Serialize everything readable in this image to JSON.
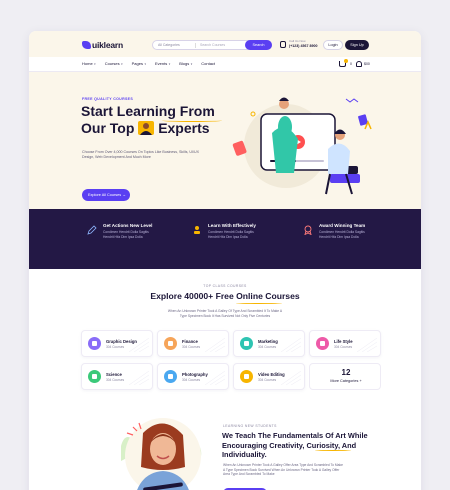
{
  "brand": {
    "name": "uiklearn",
    "accent": "#5a3ff2",
    "dark": "#231845",
    "yellow": "#f7b500",
    "cream": "#fbf6ea"
  },
  "header": {
    "category": "All Categories",
    "search_placeholder": "Search Courses",
    "search_label": "Search",
    "phone_label": "Call Us Now",
    "phone": "(+123) 4567 8900",
    "login": "Login",
    "signup": "Sign Up"
  },
  "nav": {
    "items": [
      "Home",
      "Courses",
      "Pages",
      "Events",
      "Blogs",
      "Contact"
    ],
    "cart_count": "0",
    "total": "$00"
  },
  "hero": {
    "eyebrow": "FREE QUALITY COURSES",
    "line1": "Start Learning From",
    "line2": "Our Top",
    "line3": "Experts",
    "sub": "Choose From Over 4,000 Courses On Topics Like Business, Skills, UI/UX Design, Web Development And Much More",
    "button": "Explore All Courses"
  },
  "features": [
    {
      "title": "Get Actions New Level",
      "desc": "Condimen Hendrit Dolla Sagitis Hendrit Hitz Dim Ipsa Dolla",
      "icon": "pencil-icon"
    },
    {
      "title": "Learn With Effectively",
      "desc": "Condimen Hendrit Dolla Sagitis Hendrit Hitz Dim Ipsa Dolla",
      "icon": "mentor-icon"
    },
    {
      "title": "Award Winning Team",
      "desc": "Condimen Hendrit Dolla Sagitis Hendrit Hitz Dim Ipsa Dolla",
      "icon": "award-icon"
    }
  ],
  "courses": {
    "tag": "TOP CLASS COURSES",
    "title": "Explore 40000+ Free Online Courses",
    "sub": "When An Unknown Printer Took A Galley Of Type And Scrambled It To Make A Type Specimen Book It Has Survived Not Only Five Centuries",
    "categories": [
      {
        "name": "Graphic Design",
        "count": "304 Courses",
        "color": "#8a6df8"
      },
      {
        "name": "Finance",
        "count": "304 Courses",
        "color": "#f6a55a"
      },
      {
        "name": "Marketing",
        "count": "304 Courses",
        "color": "#2fc4b2"
      },
      {
        "name": "Life Style",
        "count": "304 Courses",
        "color": "#ee5aa8"
      },
      {
        "name": "Science",
        "count": "304 Courses",
        "color": "#3bc97a"
      },
      {
        "name": "Photography",
        "count": "304 Courses",
        "color": "#4aa8f0"
      },
      {
        "name": "Video Editing",
        "count": "304 Courses",
        "color": "#f7b500"
      }
    ],
    "more_num": "12",
    "more_label": "More Categories +"
  },
  "bottom": {
    "tag": "LEARNING NEW STUDENTS",
    "title": "We Teach The Fundamentals Of Art While Encouraging Creativity, Curiosity, And Individuality.",
    "sub": "When An Unknown Printer Took A Galley Offer Area Type And Scrambled To Make A Type Specimen Book Survived When An Unknown Printer Took A Galley Offer Area Type And Scrambled To Make"
  }
}
